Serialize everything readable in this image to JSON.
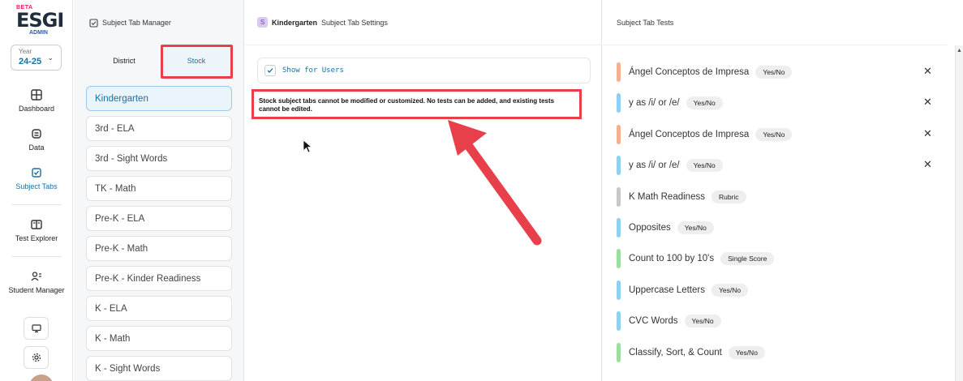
{
  "sidebar": {
    "logo": {
      "beta": "BETA",
      "brand": "ESGI",
      "admin": "ADMIN"
    },
    "year": {
      "label": "Year",
      "value": "24-25"
    },
    "items": [
      {
        "label": "Dashboard",
        "icon": "dashboard-icon"
      },
      {
        "label": "Data",
        "icon": "data-icon"
      },
      {
        "label": "Subject Tabs",
        "icon": "subject-tabs-icon",
        "active": true
      },
      {
        "label": "Test Explorer",
        "icon": "test-explorer-icon"
      },
      {
        "label": "Student Manager",
        "icon": "student-manager-icon"
      }
    ]
  },
  "manager": {
    "title": "Subject Tab Manager",
    "tabs": {
      "district": "District",
      "stock": "Stock"
    },
    "subjects": [
      "Kindergarten",
      "3rd - ELA",
      "3rd - Sight Words",
      "TK - Math",
      "Pre-K - ELA",
      "Pre-K - Math",
      "Pre-K - Kinder Readiness",
      "K - ELA",
      "K - Math",
      "K - Sight Words"
    ]
  },
  "settings": {
    "badge": "S",
    "subject": "Kindergarten",
    "title": "Subject Tab Settings",
    "show_for_users": "Show for Users",
    "notice": "Stock subject tabs cannot be modified or customized. No tests can be added, and existing tests cannot be edited."
  },
  "tests_panel": {
    "title": "Subject Tab Tests",
    "tests": [
      {
        "name": "Ángel Conceptos de Impresa",
        "type": "Yes/No",
        "color": "#f4b08f",
        "removable": true
      },
      {
        "name": "y as /i/ or /e/",
        "type": "Yes/No",
        "color": "#8fd0ef",
        "removable": true
      },
      {
        "name": "Ángel Conceptos de Impresa",
        "type": "Yes/No",
        "color": "#f4b08f",
        "removable": true
      },
      {
        "name": "y as /i/ or /e/",
        "type": "Yes/No",
        "color": "#8fd0ef",
        "removable": true
      },
      {
        "name": "K Math Readiness",
        "type": "Rubric",
        "color": "#c8c8c8",
        "removable": false
      },
      {
        "name": "Opposites",
        "type": "Yes/No",
        "color": "#8fd0ef",
        "removable": false
      },
      {
        "name": "Count to 100 by 10's",
        "type": "Single Score",
        "color": "#9adf9e",
        "removable": false
      },
      {
        "name": "Uppercase Letters",
        "type": "Yes/No",
        "color": "#8fd0ef",
        "removable": false
      },
      {
        "name": "CVC Words",
        "type": "Yes/No",
        "color": "#8fd0ef",
        "removable": false
      },
      {
        "name": "Classify, Sort, & Count",
        "type": "Yes/No",
        "color": "#9adf9e",
        "removable": false
      }
    ]
  },
  "annotation_color": "#e8404a",
  "accent": "#1b6f9e"
}
